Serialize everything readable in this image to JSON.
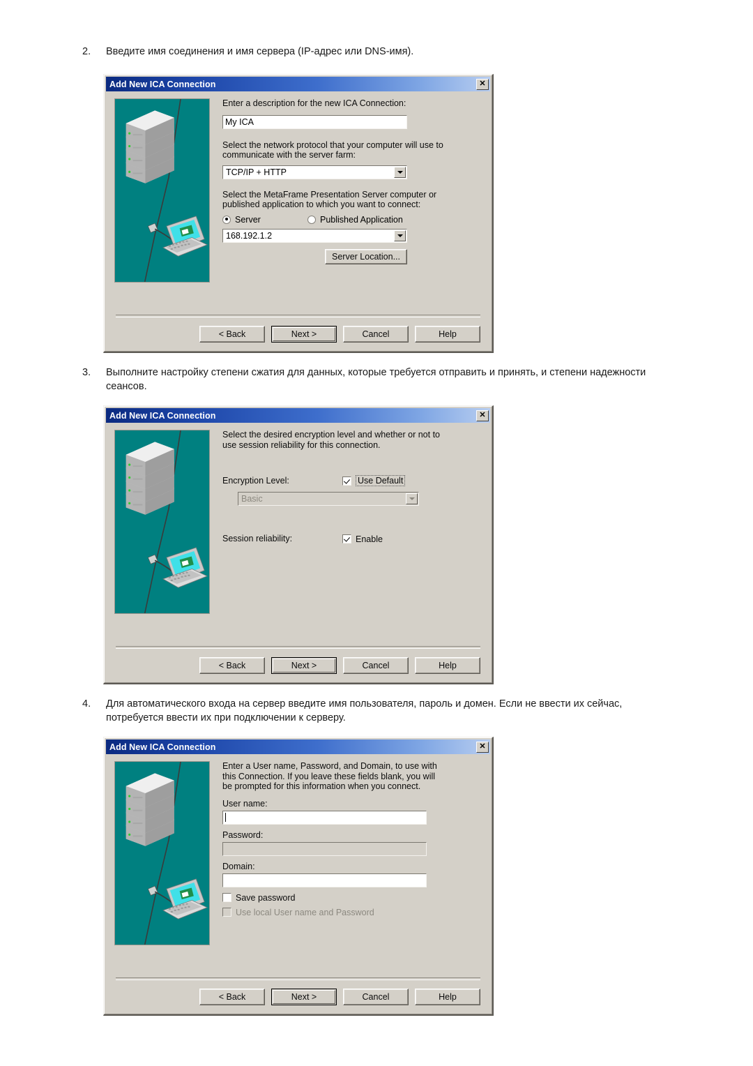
{
  "page": {
    "steps": [
      {
        "num": "2.",
        "text": "Введите имя соединения и имя сервера (IP-адрес или DNS-имя)."
      },
      {
        "num": "3.",
        "text": "Выполните настройку степени сжатия для данных, которые требуется отправить и принять, и степени надежности сеансов."
      },
      {
        "num": "4.",
        "text": "Для автоматического входа на сервер введите имя пользователя, пароль и домен. Если не ввести их сейчас, потребуется ввести их при подключении к серверу."
      }
    ]
  },
  "colors": {
    "titlebar_start": "#0b2a80",
    "titlebar_end": "#b7cdf0",
    "dialog_face": "#d4d0c8",
    "illustration_bg": "#008080",
    "laptop_screen": "#40e0e8",
    "led_green": "#33cc33"
  },
  "dialog_common": {
    "title": "Add New ICA Connection",
    "close_label": "✕",
    "buttons": {
      "back": "< Back",
      "next": "Next >",
      "cancel": "Cancel",
      "help": "Help"
    }
  },
  "dialog1": {
    "title": "Add New ICA Connection",
    "description_label": "Enter a description for the new ICA Connection:",
    "description_value": "My ICA",
    "protocol_label_line1": "Select the network protocol that your computer will use to",
    "protocol_label_line2": "communicate with the server farm:",
    "protocol_value": "TCP/IP + HTTP",
    "target_label_line1": "Select the MetaFrame Presentation Server computer or",
    "target_label_line2": "published application to which you want to connect:",
    "radio_server": "Server",
    "radio_published_app": "Published Application",
    "radio_selected": "Server",
    "server_value": "168.192.1.2",
    "server_location_button": "Server Location..."
  },
  "dialog2": {
    "title": "Add New ICA Connection",
    "description_line1": "Select the desired encryption level and whether or not to",
    "description_line2": "use session reliability for this connection.",
    "encryption_label": "Encryption Level:",
    "use_default_label": "Use Default",
    "use_default_checked": true,
    "encryption_value": "Basic",
    "encryption_enabled": false,
    "session_reliability_label": "Session reliability:",
    "enable_label": "Enable",
    "enable_checked": true
  },
  "dialog3": {
    "title": "Add New ICA Connection",
    "description_line1": "Enter a User name, Password, and Domain, to use with",
    "description_line2": "this Connection.  If you leave these fields blank, you will",
    "description_line3": "be prompted for this information when you connect.",
    "username_label": "User name:",
    "username_value": "",
    "password_label": "Password:",
    "password_value": "",
    "domain_label": "Domain:",
    "domain_value": "",
    "save_password_label": "Save password",
    "save_password_checked": false,
    "use_local_label": "Use local User name and Password",
    "use_local_checked": false,
    "use_local_enabled": false
  }
}
